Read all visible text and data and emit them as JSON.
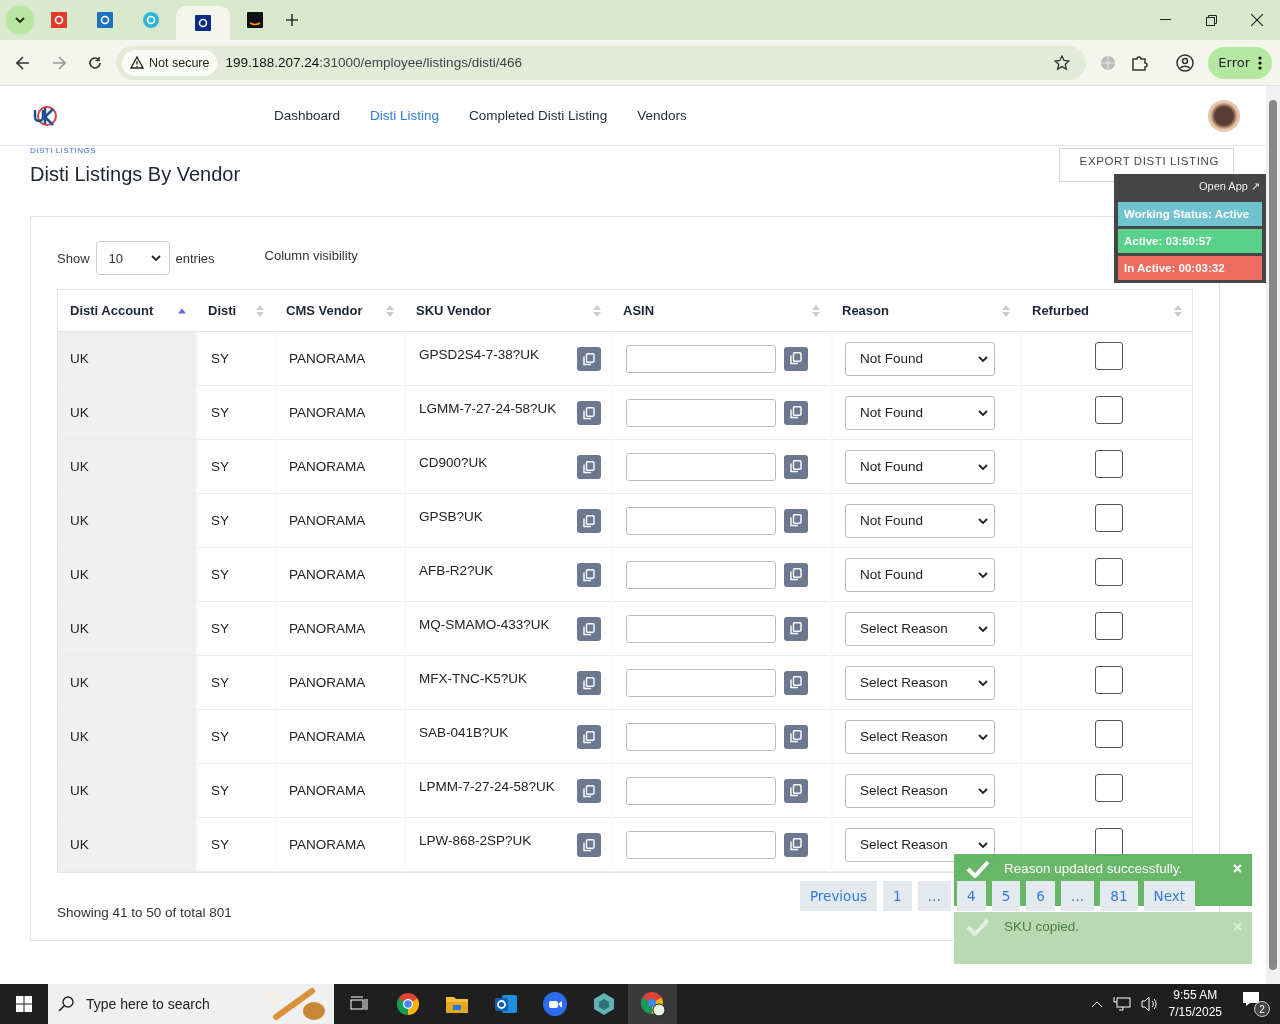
{
  "browser": {
    "tabs": [
      {
        "kind": "red",
        "selected": false
      },
      {
        "kind": "blue",
        "selected": false
      },
      {
        "kind": "cyan",
        "selected": false
      },
      {
        "kind": "navy",
        "selected": true
      },
      {
        "kind": "black",
        "selected": false
      }
    ],
    "security": "Not secure",
    "url_host": "199.188.207.24",
    "url_path": ":31000/employee/listings/disti/466",
    "profile_button": "Error"
  },
  "nav": {
    "items": [
      {
        "label": "Dashboard",
        "selected": false
      },
      {
        "label": "Disti Listing",
        "selected": true
      },
      {
        "label": "Completed Disti Listing",
        "selected": false
      },
      {
        "label": "Vendors",
        "selected": false
      }
    ]
  },
  "breadcrumb": "DISTI LISTINGS",
  "title": "Disti Listings By Vendor",
  "export_button": "EXPORT DISTI LISTING",
  "controls": {
    "show_label": "Show",
    "entries_value": "10",
    "entries_label": "entries",
    "column_visibility": "Column visibility"
  },
  "table": {
    "columns": [
      {
        "label": "Disti Account",
        "sorted": true
      },
      {
        "label": "Disti",
        "sorted": false
      },
      {
        "label": "CMS Vendor",
        "sorted": false
      },
      {
        "label": "SKU Vendor",
        "sorted": false
      },
      {
        "label": "ASIN",
        "sorted": false
      },
      {
        "label": "Reason",
        "sorted": false
      },
      {
        "label": "Refurbed",
        "sorted": false
      }
    ],
    "rows": [
      {
        "account": "UK",
        "disti": "SY",
        "cms_vendor": "PANORAMA",
        "sku": "GPSD2S4-7-38?UK",
        "reason": "Not Found",
        "refurbed": false
      },
      {
        "account": "UK",
        "disti": "SY",
        "cms_vendor": "PANORAMA",
        "sku": "LGMM-7-27-24-58?UK",
        "reason": "Not Found",
        "refurbed": false
      },
      {
        "account": "UK",
        "disti": "SY",
        "cms_vendor": "PANORAMA",
        "sku": "CD900?UK",
        "reason": "Not Found",
        "refurbed": false
      },
      {
        "account": "UK",
        "disti": "SY",
        "cms_vendor": "PANORAMA",
        "sku": "GPSB?UK",
        "reason": "Not Found",
        "refurbed": false
      },
      {
        "account": "UK",
        "disti": "SY",
        "cms_vendor": "PANORAMA",
        "sku": "AFB-R2?UK",
        "reason": "Not Found",
        "refurbed": false
      },
      {
        "account": "UK",
        "disti": "SY",
        "cms_vendor": "PANORAMA",
        "sku": "MQ-SMAMO-433?UK",
        "reason": "Select Reason",
        "refurbed": false
      },
      {
        "account": "UK",
        "disti": "SY",
        "cms_vendor": "PANORAMA",
        "sku": "MFX-TNC-K5?UK",
        "reason": "Select Reason",
        "refurbed": false
      },
      {
        "account": "UK",
        "disti": "SY",
        "cms_vendor": "PANORAMA",
        "sku": "SAB-041B?UK",
        "reason": "Select Reason",
        "refurbed": false
      },
      {
        "account": "UK",
        "disti": "SY",
        "cms_vendor": "PANORAMA",
        "sku": "LPMM-7-27-24-58?UK",
        "reason": "Select Reason",
        "refurbed": false
      },
      {
        "account": "UK",
        "disti": "SY",
        "cms_vendor": "PANORAMA",
        "sku": "LPW-868-2SP?UK",
        "reason": "Select Reason",
        "refurbed": false
      }
    ]
  },
  "info": "Showing 41 to 50 of total 801",
  "pagination": [
    "Previous",
    "1",
    "…",
    "4",
    "5",
    "6",
    "…",
    "81",
    "Next"
  ],
  "status_widget": {
    "open_app": "Open App ↗",
    "items": [
      {
        "label": "Working Status: Active",
        "color": "#72c3d0"
      },
      {
        "label": "Active: 03:50:57",
        "color": "#58d18a"
      },
      {
        "label": "In Active: 00:03:32",
        "color": "#ec6c5f"
      }
    ]
  },
  "toasts": [
    {
      "message": "Reason updated successfully.",
      "fading": false
    },
    {
      "message": "SKU copied.",
      "fading": true
    }
  ],
  "taskbar": {
    "search_placeholder": "Type here to search",
    "time": "9:55 AM",
    "date": "7/15/2025",
    "notifications": "2"
  }
}
